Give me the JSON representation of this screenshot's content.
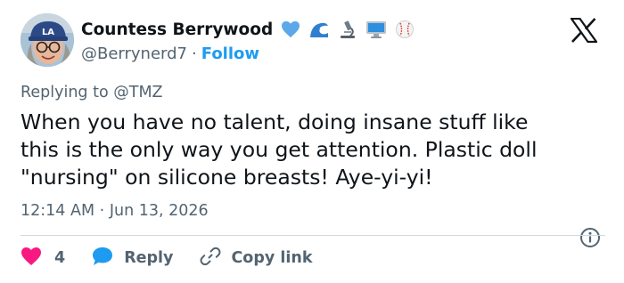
{
  "author": {
    "display_name": "Countess Berrywood",
    "handle": "@Berrynerd7",
    "separator": "·",
    "follow_label": "Follow",
    "emojis": [
      "blue-heart-icon",
      "wave-icon",
      "microscope-icon",
      "computer-icon",
      "baseball-icon"
    ]
  },
  "reply_context": {
    "prefix": "Replying to",
    "mention": "@TMZ"
  },
  "tweet": {
    "lines": [
      "When you have no talent, doing insane stuff like",
      "this is the only way you get attention. Plastic doll",
      "\"nursing\" on silicone breasts! Aye-yi-yi!"
    ]
  },
  "meta": {
    "time": "12:14 AM",
    "separator": "·",
    "date": "Jun 13, 2026"
  },
  "actions": {
    "like_count": "4",
    "reply_label": "Reply",
    "copy_link_label": "Copy link"
  },
  "colors": {
    "accent": "#1d9bf0",
    "like": "#f91880",
    "text": "#0f1419",
    "muted": "#536471"
  }
}
